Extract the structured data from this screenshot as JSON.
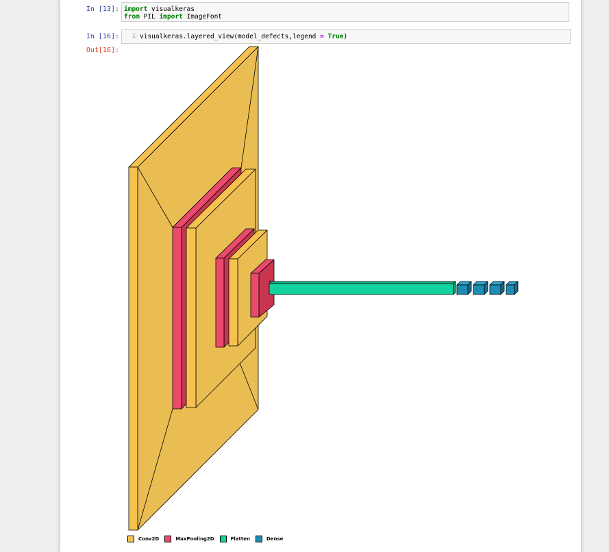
{
  "cells": {
    "in13": {
      "prompt": "In [13]:",
      "line1": {
        "kw": "import",
        "rest": " visualkeras"
      },
      "line2": {
        "kw1": "from",
        "mid": " PIL ",
        "kw2": "import",
        "rest": " ImageFont"
      }
    },
    "in16": {
      "prompt": "In [16]:",
      "line_number": "1",
      "code_pre": "visualkeras.layered_view(model_defects,legend ",
      "code_op": "=",
      "code_space": " ",
      "code_kw": "True",
      "code_post": ")"
    },
    "out16": {
      "prompt": "Out[16]:"
    }
  },
  "legend": [
    {
      "label": "Conv2D",
      "color": "#f6c24f"
    },
    {
      "label": "MaxPooling2D",
      "color": "#e84a6b"
    },
    {
      "label": "Flatten",
      "color": "#14d29b"
    },
    {
      "label": "Dense",
      "color": "#1f8db3"
    }
  ],
  "colors": {
    "conv2d": "#f6c24f",
    "conv2d_face": "#eabd52",
    "maxpool": "#ea4a6c",
    "maxpool_dark": "#c9354f",
    "flatten": "#12d39d",
    "dense": "#1e8db4",
    "dense_dark": "#166f8f"
  }
}
